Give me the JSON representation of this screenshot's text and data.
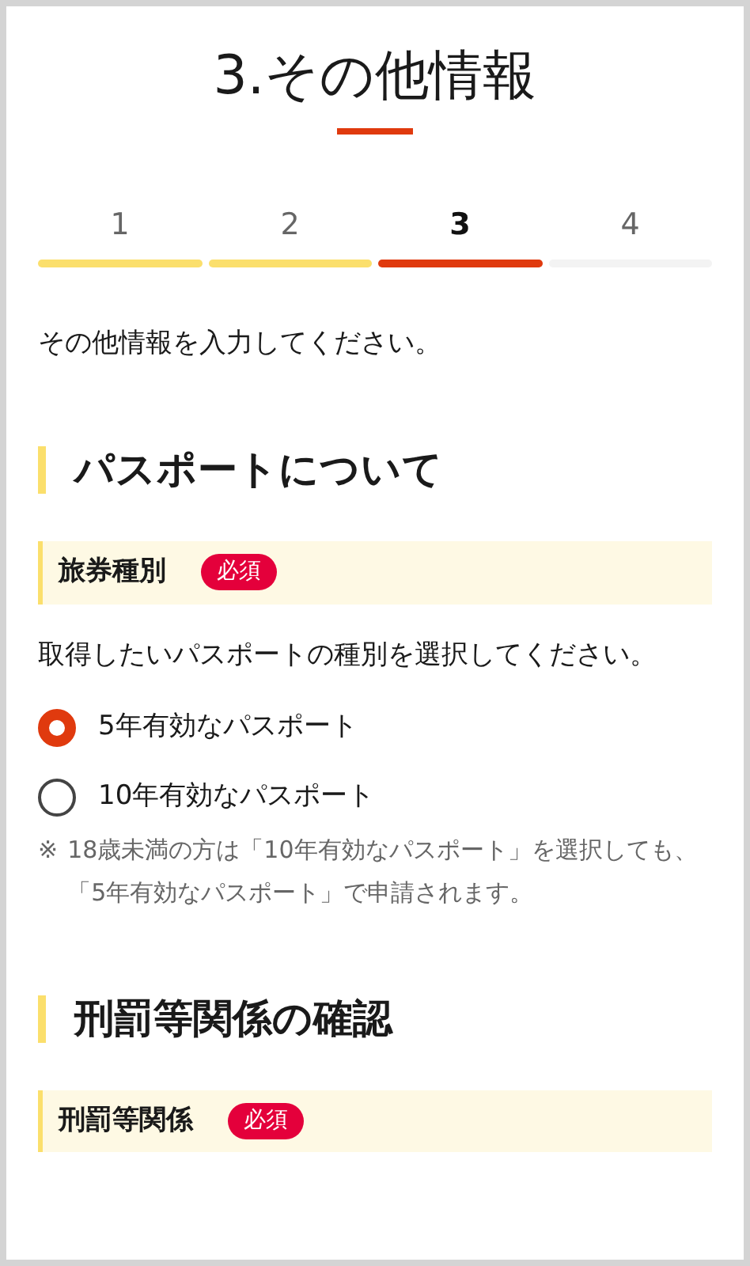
{
  "page_title": "3.その他情報",
  "steps": [
    {
      "label": "1",
      "completed": true,
      "selected": false
    },
    {
      "label": "2",
      "completed": true,
      "selected": false
    },
    {
      "label": "3",
      "completed": false,
      "selected": true
    },
    {
      "label": "4",
      "completed": false,
      "selected": false
    }
  ],
  "intro": "その他情報を入力してください。",
  "sections": [
    {
      "heading": "パスポートについて",
      "fields": [
        {
          "label": "旅券種別",
          "badge": "必須",
          "description": "取得したいパスポートの種別を選択してください。",
          "options": [
            {
              "label": "5年有効なパスポート",
              "selected": true
            },
            {
              "label": "10年有効なパスポート",
              "selected": false
            }
          ],
          "note_mark": "※",
          "note": "18歳未満の方は「10年有効なパスポート」を選択しても、「5年有効なパスポート」で申請されます。"
        }
      ]
    },
    {
      "heading": "刑罰等関係の確認",
      "fields": [
        {
          "label": "刑罰等関係",
          "badge": "必須"
        }
      ]
    }
  ]
}
